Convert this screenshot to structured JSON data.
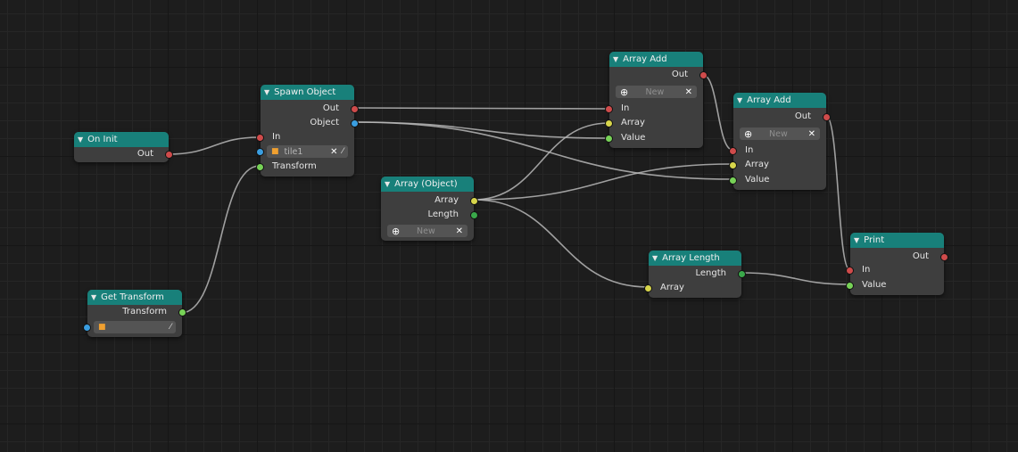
{
  "colors": {
    "exec_socket": "#cf4b4b",
    "object_socket": "#3a9ee0",
    "transform_socket": "#77d257",
    "array_socket": "#d7d54b",
    "length_socket": "#3aa84a",
    "header": "#18807a",
    "node_body": "#3e3e3e",
    "link": "#b7b7b7"
  },
  "nodes": {
    "on_init": {
      "title": "On Init",
      "out": "Out"
    },
    "get_transform": {
      "title": "Get Transform",
      "transform": "Transform"
    },
    "spawn_object": {
      "title": "Spawn Object",
      "out": "Out",
      "object": "Object",
      "in": "In",
      "object_value": "tile1",
      "transform": "Transform"
    },
    "array_object": {
      "title": "Array (Object)",
      "array": "Array",
      "length": "Length",
      "new_placeholder": "New"
    },
    "array_add_1": {
      "title": "Array Add",
      "out": "Out",
      "new_placeholder": "New",
      "in": "In",
      "array": "Array",
      "value": "Value"
    },
    "array_add_2": {
      "title": "Array Add",
      "out": "Out",
      "new_placeholder": "New",
      "in": "In",
      "array": "Array",
      "value": "Value"
    },
    "array_length": {
      "title": "Array Length",
      "length": "Length",
      "array": "Array"
    },
    "print": {
      "title": "Print",
      "out": "Out",
      "in": "In",
      "value": "Value"
    }
  },
  "icons": {
    "collapse": "▼",
    "plus": "⊕",
    "close": "✕",
    "cube": "■",
    "pipette": "⁄"
  }
}
